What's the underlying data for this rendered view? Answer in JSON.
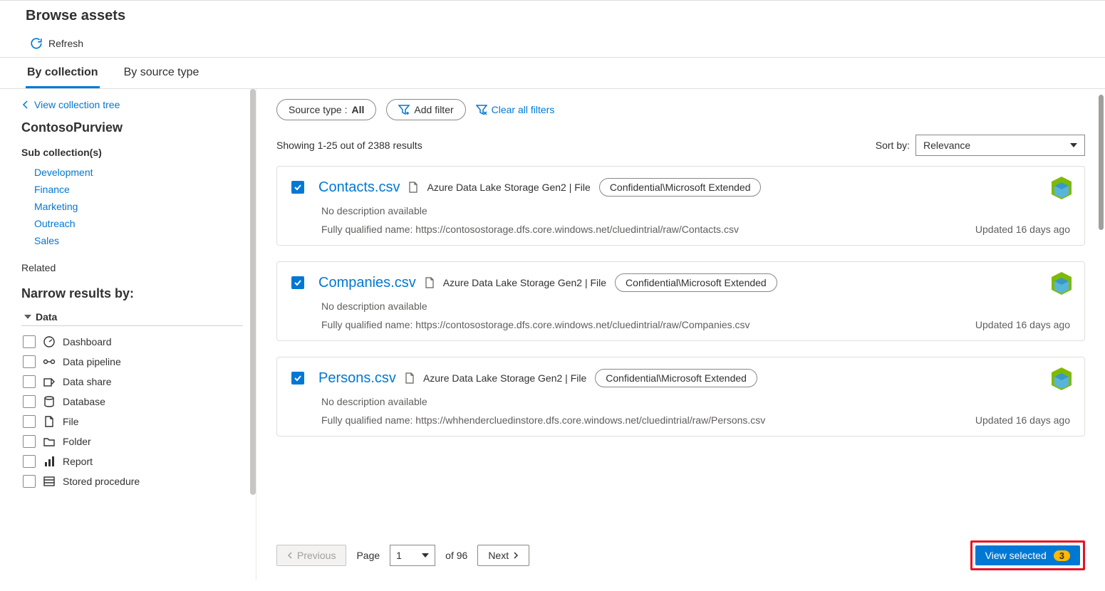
{
  "page_title": "Browse assets",
  "refresh_label": "Refresh",
  "tabs": {
    "by_collection": "By collection",
    "by_source": "By source type"
  },
  "sidebar": {
    "back_link": "View collection tree",
    "collection_name": "ContosoPurview",
    "sub_title": "Sub collection(s)",
    "subs": [
      "Development",
      "Finance",
      "Marketing",
      "Outreach",
      "Sales"
    ],
    "related_title": "Related",
    "narrow_title": "Narrow results by:",
    "facet_group": "Data",
    "facets": [
      "Dashboard",
      "Data pipeline",
      "Data share",
      "Database",
      "File",
      "Folder",
      "Report",
      "Stored procedure"
    ]
  },
  "filters": {
    "source_type_key": "Source type : ",
    "source_type_val": "All",
    "add_filter": "Add filter",
    "clear_all": "Clear all filters"
  },
  "results_header": {
    "showing": "Showing 1-25 out of 2388 results",
    "sort_label": "Sort by:",
    "sort_value": "Relevance"
  },
  "cards": [
    {
      "name": "Contacts.csv",
      "source": "Azure Data Lake Storage Gen2 | File",
      "classification": "Confidential\\Microsoft Extended",
      "desc": "No description available",
      "fqn": "Fully qualified name: https://contosostorage.dfs.core.windows.net/cluedintrial/raw/Contacts.csv",
      "updated": "Updated 16 days ago"
    },
    {
      "name": "Companies.csv",
      "source": "Azure Data Lake Storage Gen2 | File",
      "classification": "Confidential\\Microsoft Extended",
      "desc": "No description available",
      "fqn": "Fully qualified name: https://contosostorage.dfs.core.windows.net/cluedintrial/raw/Companies.csv",
      "updated": "Updated 16 days ago"
    },
    {
      "name": "Persons.csv",
      "source": "Azure Data Lake Storage Gen2 | File",
      "classification": "Confidential\\Microsoft Extended",
      "desc": "No description available",
      "fqn": "Fully qualified name: https://whhendercluedinstore.dfs.core.windows.net/cluedintrial/raw/Persons.csv",
      "updated": "Updated 16 days ago"
    }
  ],
  "footer": {
    "previous": "Previous",
    "page_label": "Page",
    "page_current": "1",
    "of_total": "of 96",
    "next": "Next",
    "view_selected": "View selected",
    "selected_count": "3"
  }
}
